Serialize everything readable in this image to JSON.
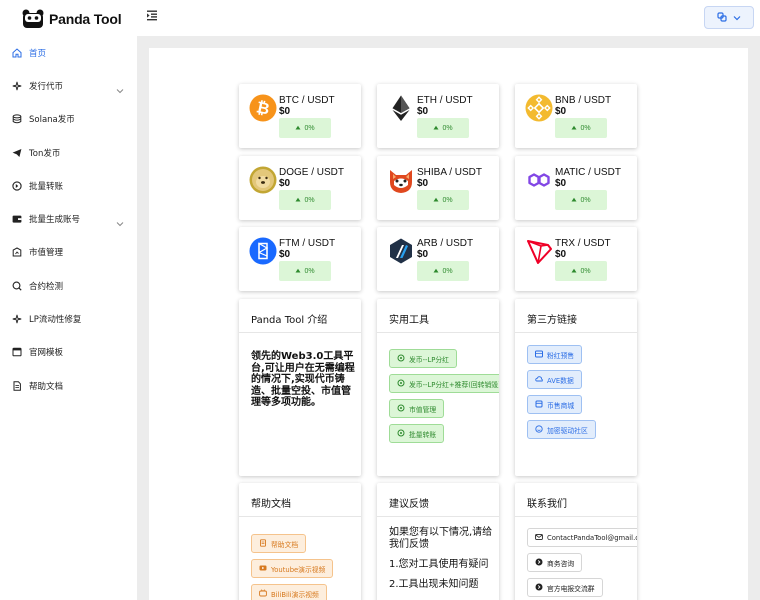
{
  "app": {
    "name": "Panda Tool"
  },
  "sidebar": {
    "items": [
      {
        "label": "首页",
        "icon": "home-icon",
        "active": true,
        "expandable": false
      },
      {
        "label": "发行代币",
        "icon": "sparkle-icon",
        "active": false,
        "expandable": true
      },
      {
        "label": "Solana发币",
        "icon": "database-icon",
        "active": false,
        "expandable": false
      },
      {
        "label": "Ton发币",
        "icon": "send-icon",
        "active": false,
        "expandable": false
      },
      {
        "label": "批量转账",
        "icon": "transfer-icon",
        "active": false,
        "expandable": false
      },
      {
        "label": "批量生成账号",
        "icon": "wallet-icon",
        "active": false,
        "expandable": true
      },
      {
        "label": "市值管理",
        "icon": "chart-icon",
        "active": false,
        "expandable": false
      },
      {
        "label": "合约检测",
        "icon": "scan-icon",
        "active": false,
        "expandable": false
      },
      {
        "label": "LP流动性修复",
        "icon": "sparkle-icon",
        "active": false,
        "expandable": false
      },
      {
        "label": "官网模板",
        "icon": "template-icon",
        "active": false,
        "expandable": false
      },
      {
        "label": "帮助文档",
        "icon": "document-icon",
        "active": false,
        "expandable": false
      }
    ]
  },
  "coins": [
    {
      "pair": "BTC / USDT",
      "price": "$0",
      "change": "0%",
      "logo": "btc-logo"
    },
    {
      "pair": "ETH / USDT",
      "price": "$0",
      "change": "0%",
      "logo": "eth-logo"
    },
    {
      "pair": "BNB / USDT",
      "price": "$0",
      "change": "0%",
      "logo": "bnb-logo"
    },
    {
      "pair": "DOGE / USDT",
      "price": "$0",
      "change": "0%",
      "logo": "doge-logo"
    },
    {
      "pair": "SHIBA / USDT",
      "price": "$0",
      "change": "0%",
      "logo": "shiba-logo"
    },
    {
      "pair": "MATIC / USDT",
      "price": "$0",
      "change": "0%",
      "logo": "matic-logo"
    },
    {
      "pair": "FTM / USDT",
      "price": "$0",
      "change": "0%",
      "logo": "ftm-logo"
    },
    {
      "pair": "ARB / USDT",
      "price": "$0",
      "change": "0%",
      "logo": "arb-logo"
    },
    {
      "pair": "TRX / USDT",
      "price": "$0",
      "change": "0%",
      "logo": "trx-logo"
    }
  ],
  "intro": {
    "title": "Panda Tool 介绍",
    "lines": [
      "领先的Web3.0工具平",
      "台,可让用户在无需编程",
      "的情况下,实现代币铸",
      "造、批量空投、市值管",
      "理等多项功能。"
    ]
  },
  "tools": {
    "title": "实用工具",
    "items": [
      {
        "label": "发币--LP分红"
      },
      {
        "label": "发币--LP分红+推荐(回转销毁)"
      },
      {
        "label": "市值管理"
      },
      {
        "label": "批量转账"
      }
    ]
  },
  "links": {
    "title": "第三方链接",
    "items": [
      {
        "label": "粉红预售"
      },
      {
        "label": "AVE数据"
      },
      {
        "label": "币售商城"
      },
      {
        "label": "加密驱动社区"
      }
    ]
  },
  "help": {
    "title": "帮助文档",
    "items": [
      {
        "label": "帮助文档"
      },
      {
        "label": "Youtube演示视频"
      },
      {
        "label": "BiliBili演示视频"
      }
    ]
  },
  "feedback": {
    "title": "建议反馈",
    "intro_lines": [
      "如果您有以下情况,请给",
      "我们反馈"
    ],
    "items": [
      "1.您对工具使用有疑问",
      "2.工具出现未知问题"
    ]
  },
  "contact": {
    "title": "联系我们",
    "items": [
      {
        "label": "ContactPandaTool@gmail.com"
      },
      {
        "label": "商务咨询"
      },
      {
        "label": "官方电报交流群"
      }
    ]
  },
  "colors": {
    "accent": "#2b6de5",
    "positive": "#2e8a2e",
    "positive_bg": "#dcf6d7",
    "link_bg": "#e2edfc",
    "doc_bg": "#fdeedd",
    "canvas": "#ececec"
  }
}
